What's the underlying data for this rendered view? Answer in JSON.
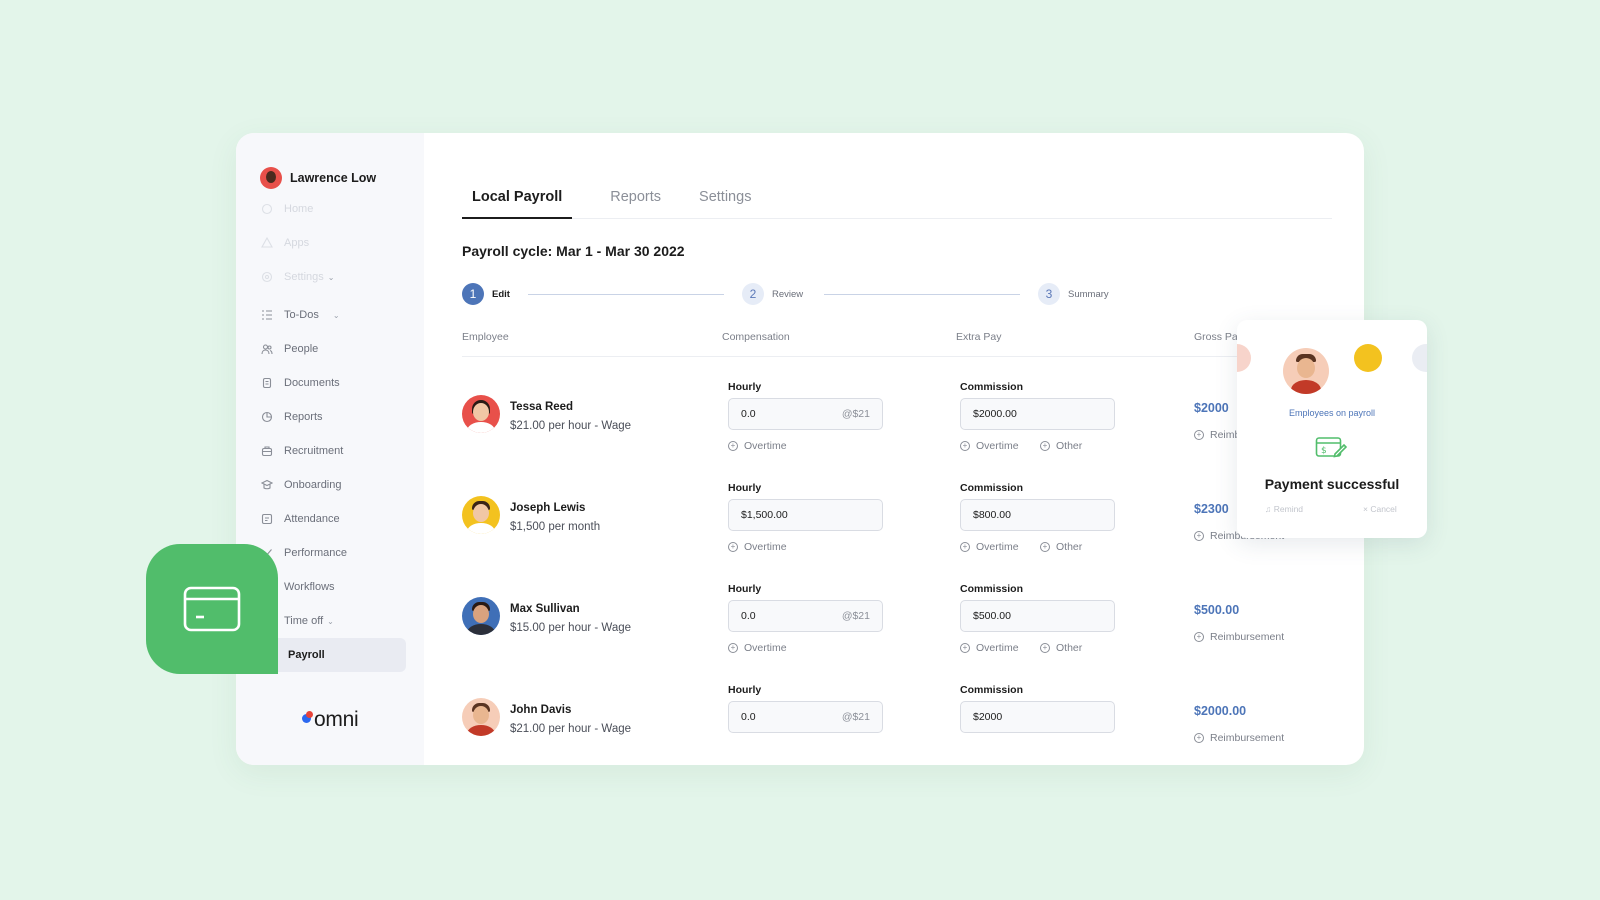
{
  "user": {
    "name": "Lawrence Low"
  },
  "sidebar": {
    "items": [
      {
        "label": "Home",
        "icon": "home-icon",
        "faded": true
      },
      {
        "label": "Apps",
        "icon": "apps-icon",
        "faded": true
      },
      {
        "label": "Settings",
        "icon": "settings-icon",
        "faded": true,
        "chevron": true
      },
      {
        "label": "To-Dos",
        "icon": "todo-icon",
        "chevron": true
      },
      {
        "label": "People",
        "icon": "people-icon"
      },
      {
        "label": "Documents",
        "icon": "documents-icon"
      },
      {
        "label": "Reports",
        "icon": "reports-icon"
      },
      {
        "label": "Recruitment",
        "icon": "recruitment-icon"
      },
      {
        "label": "Onboarding",
        "icon": "onboarding-icon"
      },
      {
        "label": "Attendance",
        "icon": "attendance-icon"
      },
      {
        "label": "Performance",
        "icon": "performance-icon"
      },
      {
        "label": "Workflows",
        "icon": "workflows-icon"
      },
      {
        "label": "Time off",
        "icon": "time-off-icon",
        "chevron": true
      },
      {
        "label": "Payroll",
        "icon": "payroll-icon",
        "active": true
      }
    ],
    "logo_text": "omni"
  },
  "tabs": [
    {
      "label": "Local Payroll",
      "active": true
    },
    {
      "label": "Reports"
    },
    {
      "label": "Settings"
    }
  ],
  "cycle_title": "Payroll cycle: Mar 1 - Mar 30 2022",
  "steps": [
    {
      "num": "1",
      "label": "Edit",
      "active": true
    },
    {
      "num": "2",
      "label": "Review"
    },
    {
      "num": "3",
      "label": "Summary"
    }
  ],
  "columns": {
    "employee": "Employee",
    "compensation": "Compensation",
    "extra_pay": "Extra Pay",
    "gross_pay": "Gross Pay"
  },
  "labels": {
    "hourly": "Hourly",
    "commission": "Commission",
    "overtime": "Overtime",
    "other": "Other",
    "reimbursement": "Reimbursement"
  },
  "employees": [
    {
      "name": "Tessa Reed",
      "rate": "$21.00 per hour - Wage",
      "hourly": "0.0",
      "hourly_suffix": "@$21",
      "commission": "$2000.00",
      "gross": "$2000"
    },
    {
      "name": "Joseph Lewis",
      "rate": "$1,500 per month",
      "hourly": "$1,500.00",
      "hourly_suffix": "",
      "commission": "$800.00",
      "gross": "$2300"
    },
    {
      "name": "Max Sullivan",
      "rate": "$15.00 per hour - Wage",
      "hourly": "0.0",
      "hourly_suffix": "@$21",
      "commission": "$500.00",
      "gross": "$500.00"
    },
    {
      "name": "John Davis",
      "rate": "$21.00 per hour - Wage",
      "hourly": "0.0",
      "hourly_suffix": "@$21",
      "commission": "$2000",
      "gross": "$2000.00"
    }
  ],
  "payment_card": {
    "caption": "Employees on payroll",
    "title": "Payment successful",
    "remind": "Remind",
    "cancel": "Cancel"
  },
  "colors": {
    "background": "#e3f5ea",
    "accent": "#4d75b8",
    "badge_green": "#51bd6b"
  }
}
